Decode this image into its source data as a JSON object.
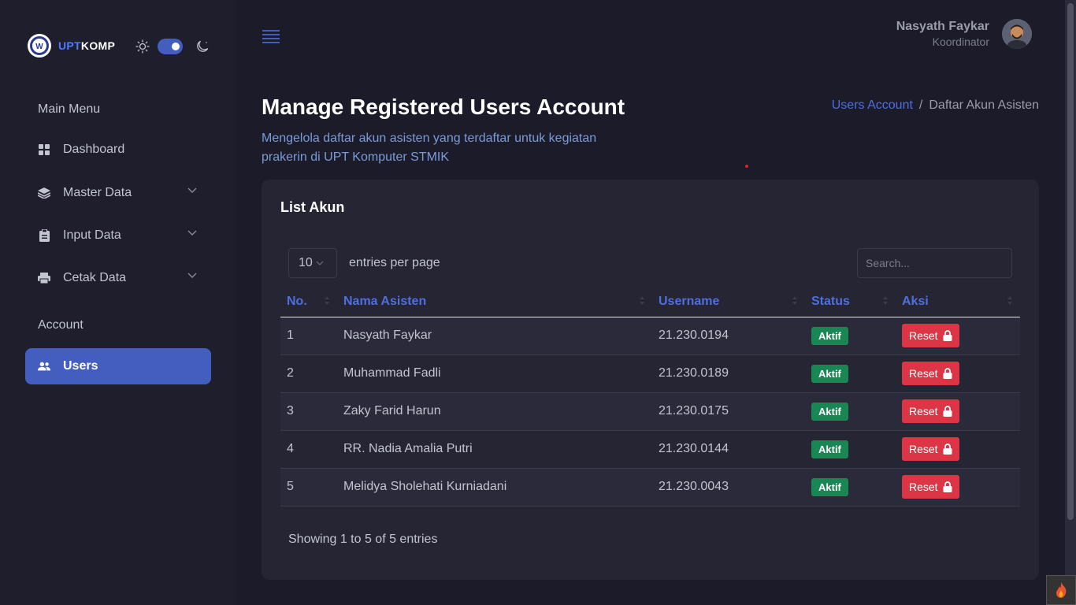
{
  "brand": {
    "accent_text": "UPT",
    "rest_text": "KOMP",
    "accent_color": "#4f7cff"
  },
  "theme": {
    "light_icon": "sun-icon",
    "dark_icon": "moon-icon",
    "dark_mode": true
  },
  "sidebar": {
    "main_menu_title": "Main Menu",
    "account_title": "Account",
    "items": [
      {
        "label": "Dashboard",
        "icon": "grid-icon"
      },
      {
        "label": "Master Data",
        "icon": "layers-icon"
      },
      {
        "label": "Input Data",
        "icon": "clipboard-icon"
      },
      {
        "label": "Cetak Data",
        "icon": "printer-icon"
      },
      {
        "label": "Users",
        "icon": "users-icon",
        "active": true
      }
    ]
  },
  "header": {
    "menu_icon": "hamburger-icon",
    "user_name": "Nasyath Faykar",
    "user_role": "Koordinator"
  },
  "page": {
    "title": "Manage Registered Users Account",
    "subtitle": "Mengelola daftar akun asisten yang terdaftar untuk kegiatan prakerin di UPT Komputer STMIK",
    "breadcrumb": {
      "link": "Users Account",
      "separator": "/",
      "current": "Daftar Akun Asisten"
    }
  },
  "card": {
    "title": "List Akun",
    "entries_value": "10",
    "entries_label": "entries per page",
    "search_placeholder": "Search...",
    "columns": [
      "No.",
      "Nama Asisten",
      "Username",
      "Status",
      "Aksi"
    ],
    "rows": [
      {
        "no": "1",
        "name": "Nasyath Faykar",
        "username": "21.230.0194",
        "status": "Aktif",
        "action": "Reset"
      },
      {
        "no": "2",
        "name": "Muhammad Fadli",
        "username": "21.230.0189",
        "status": "Aktif",
        "action": "Reset"
      },
      {
        "no": "3",
        "name": "Zaky Farid Harun",
        "username": "21.230.0175",
        "status": "Aktif",
        "action": "Reset"
      },
      {
        "no": "4",
        "name": "RR. Nadia Amalia Putri",
        "username": "21.230.0144",
        "status": "Aktif",
        "action": "Reset"
      },
      {
        "no": "5",
        "name": "Melidya Sholehati Kurniadani",
        "username": "21.230.0043",
        "status": "Aktif",
        "action": "Reset"
      }
    ],
    "footer": "Showing 1 to 5 of 5 entries"
  },
  "colors": {
    "primary": "#435ebe",
    "success": "#198754",
    "danger": "#dc3545"
  }
}
